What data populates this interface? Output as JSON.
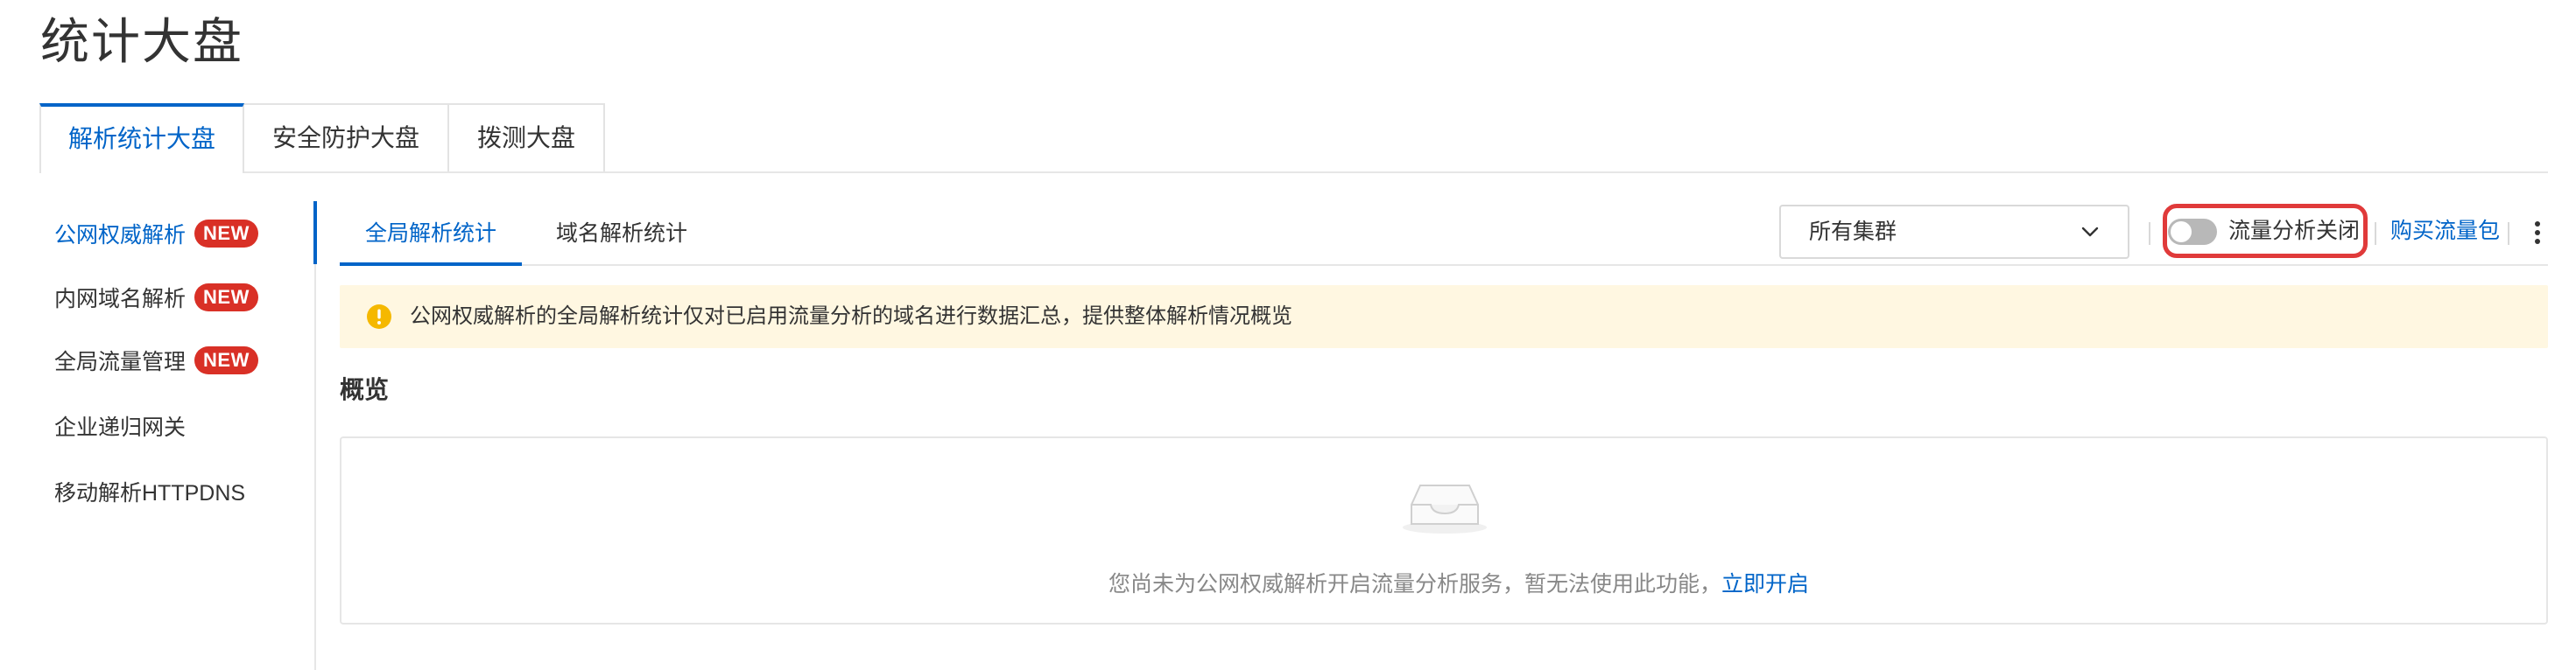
{
  "page": {
    "title": "统计大盘"
  },
  "top_tabs": [
    {
      "label": "解析统计大盘",
      "active": true
    },
    {
      "label": "安全防护大盘",
      "active": false
    },
    {
      "label": "拨测大盘",
      "active": false
    }
  ],
  "left_nav": {
    "items": [
      {
        "label": "公网权威解析",
        "badge": "NEW",
        "active": true
      },
      {
        "label": "内网域名解析",
        "badge": "NEW",
        "active": false
      },
      {
        "label": "全局流量管理",
        "badge": "NEW",
        "active": false
      },
      {
        "label": "企业递归网关",
        "badge": "",
        "active": false
      },
      {
        "label": "移动解析HTTPDNS",
        "badge": "",
        "active": false
      }
    ]
  },
  "sub_tabs": [
    {
      "label": "全局解析统计",
      "active": true
    },
    {
      "label": "域名解析统计",
      "active": false
    }
  ],
  "toolbar": {
    "cluster_select_value": "所有集群",
    "toggle_label": "流量分析关闭",
    "toggle_on": false,
    "buy_link": "购买流量包"
  },
  "alert": {
    "text": "公网权威解析的全局解析统计仅对已启用流量分析的域名进行数据汇总，提供整体解析情况概览"
  },
  "overview": {
    "title": "概览",
    "empty_text": "您尚未为公网权威解析开启流量分析服务，暂无法使用此功能，",
    "enable_link": "立即开启"
  },
  "colors": {
    "primary": "#0064c8",
    "badge": "#d93026",
    "alert_bg": "#fff7e1",
    "warning": "#f5b800",
    "highlight_box": "#e03a3a"
  }
}
